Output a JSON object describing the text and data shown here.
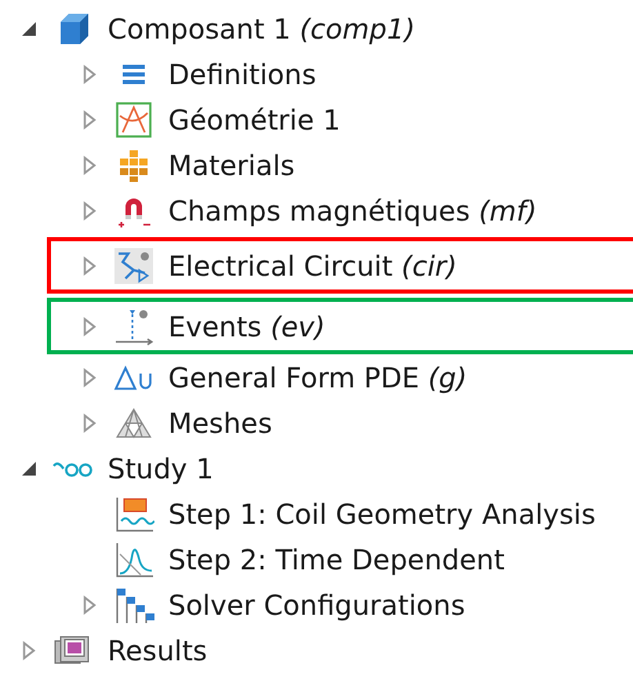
{
  "tree": [
    {
      "label": "Composant 1 *(comp1)*",
      "kind": "cube",
      "expanded": true,
      "children": [
        {
          "label": "Definitions",
          "kind": "definitions",
          "expanded": false
        },
        {
          "label": "Géométrie 1",
          "kind": "geometry",
          "expanded": false
        },
        {
          "label": "Materials",
          "kind": "materials",
          "expanded": false
        },
        {
          "label": "Champs magnétiques *(mf)*",
          "kind": "magnet",
          "expanded": false
        },
        {
          "label": "Electrical Circuit *(cir)*",
          "kind": "circuit",
          "expanded": false,
          "color": "#ff0000"
        },
        {
          "label": "Events *(ev)*",
          "kind": "events",
          "expanded": false,
          "color": "#00b050"
        },
        {
          "label": "General Form PDE *(g)*",
          "kind": "delta",
          "expanded": false
        },
        {
          "label": "Meshes",
          "kind": "mesh",
          "expanded": false
        }
      ]
    },
    {
      "label": "Study 1",
      "kind": "study",
      "expanded": true,
      "children": [
        {
          "label": "Step 1: Coil Geometry Analysis",
          "kind": "coilstep"
        },
        {
          "label": "Step 2: Time Dependent",
          "kind": "timestep"
        },
        {
          "label": "Solver Configurations",
          "kind": "solver",
          "expanded": false
        }
      ]
    },
    {
      "label": "Results",
      "kind": "results",
      "expanded": false
    }
  ]
}
